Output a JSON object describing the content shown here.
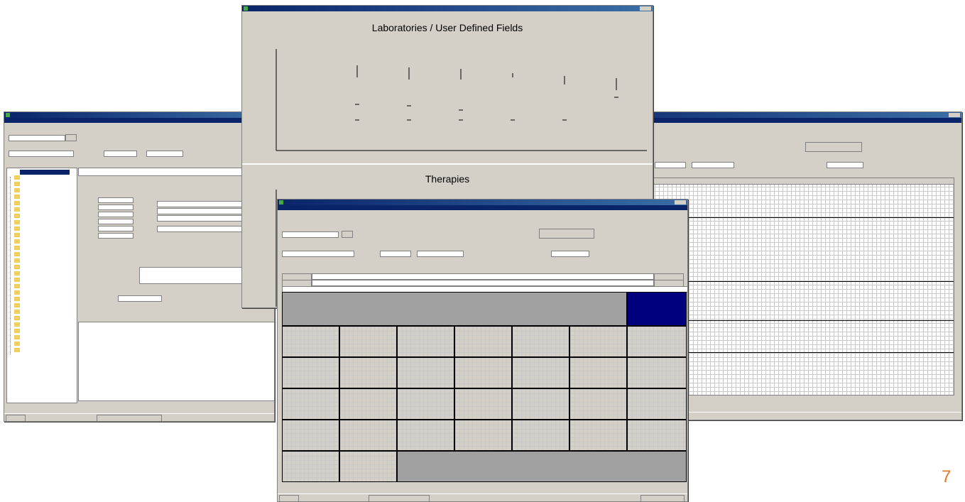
{
  "page_number": "7",
  "chart_window": {
    "chart1": {
      "title": "Laboratories / User Defined Fields"
    },
    "chart2": {
      "title": "Therapies"
    }
  },
  "colors": {
    "titlebar": "#0a246a",
    "window": "#d4d0c8",
    "selected_cell": "#00007f",
    "page_number": "#e07820"
  }
}
